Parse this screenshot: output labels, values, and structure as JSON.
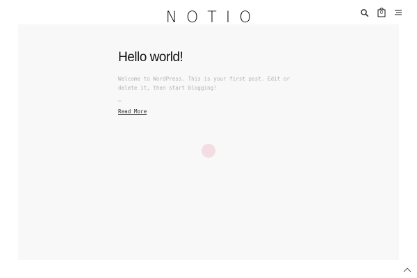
{
  "header": {
    "logo_text": "NOTIO",
    "icons": {
      "search": "search-icon",
      "cart": "cart-icon",
      "menu": "menu-icon"
    },
    "cart_count": "0"
  },
  "post": {
    "title": "Hello world!",
    "excerpt": "Welcome to WordPress. This is your first post. Edit or delete it, then start blogging!",
    "ellipsis": "…",
    "read_more_label": "Read More"
  },
  "footer": {
    "back_to_top_icon": "chevron-up-icon"
  },
  "colors": {
    "content_background": "#f8f8f8",
    "loader_accent": "#f3dde2",
    "text_primary": "#111111",
    "text_muted": "#b3b3b3"
  }
}
